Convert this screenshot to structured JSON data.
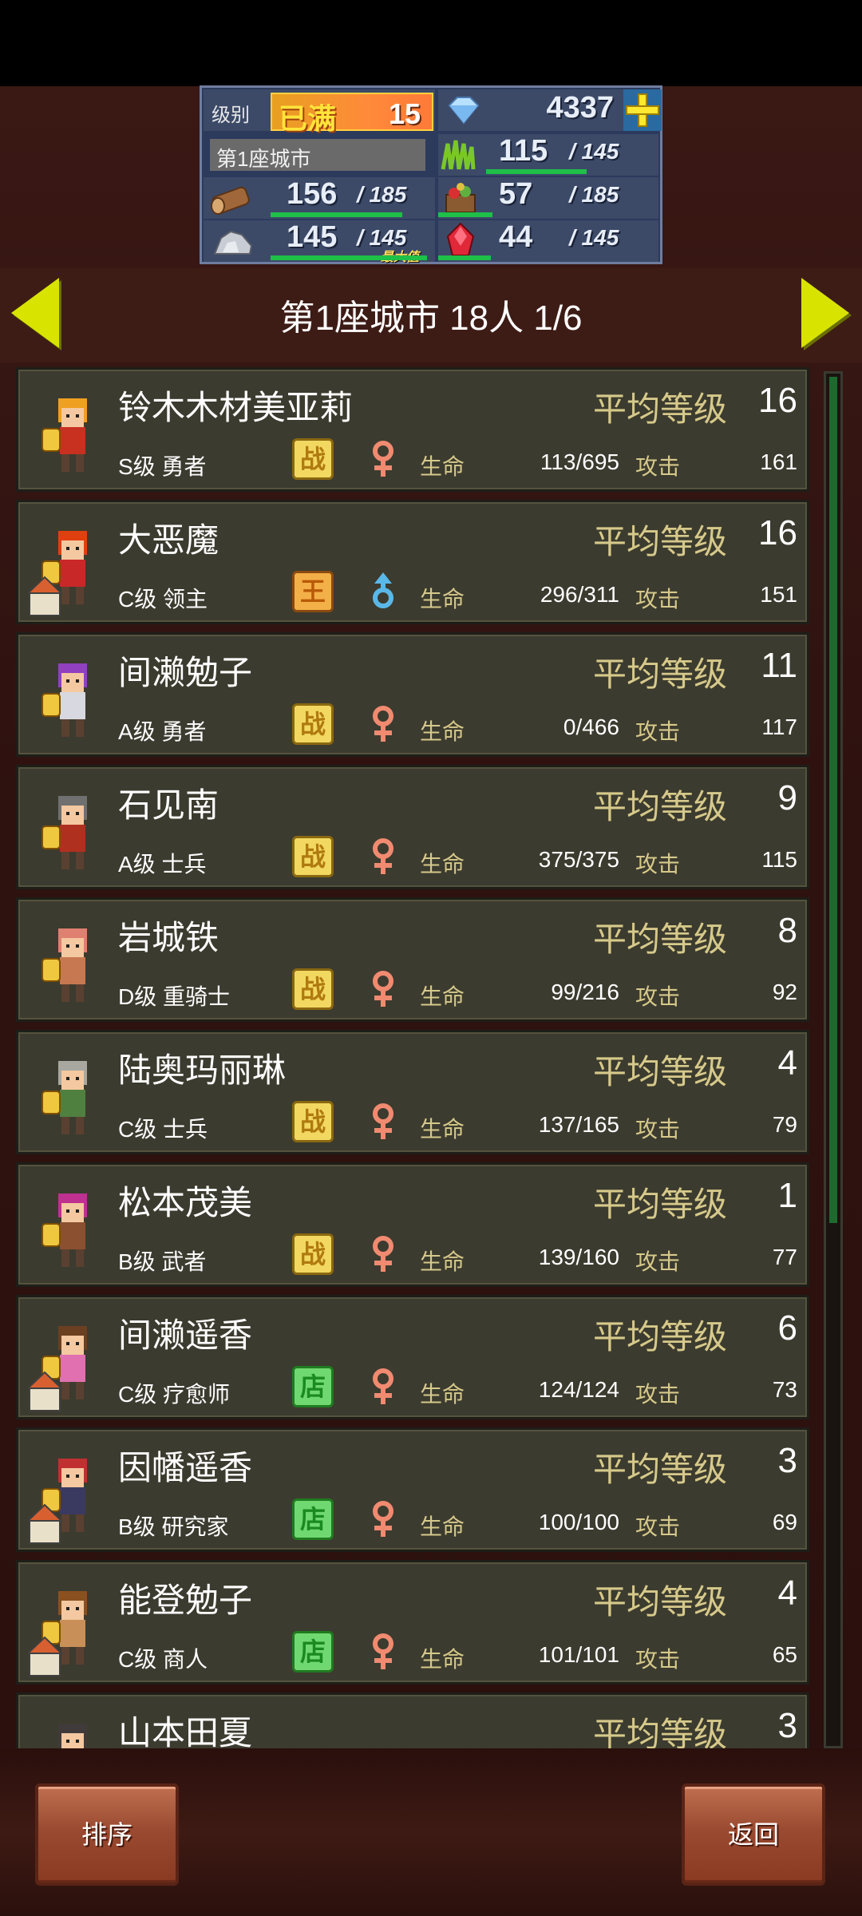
{
  "status": {
    "level_label": "级别",
    "max_label": "已满",
    "level": "15",
    "gems": "4337",
    "city_label": "第1座城市",
    "grass_current": "115",
    "grass_max": "/ 145",
    "wood_current": "156",
    "wood_max": "/ 185",
    "food_current": "57",
    "food_max": "/ 185",
    "ore_current": "145",
    "ore_max": "/ 145",
    "ore_maxtag": "最大值",
    "gem2_current": "44",
    "gem2_max": "/ 145",
    "fill": {
      "grass": 0.79,
      "wood": 0.84,
      "food": 0.31,
      "ore": 1.0,
      "gem2": 0.3
    }
  },
  "header": {
    "title": "第1座城市  18人 1/6"
  },
  "labels": {
    "avg_level": "平均等级",
    "hp": "生命",
    "attack": "攻击"
  },
  "characters": [
    {
      "name": "铃木木材美亚莉",
      "level": "16",
      "class": "S级 勇者",
      "badge": "战",
      "gender": "female",
      "hp": "113/695",
      "atk": "161",
      "house": false,
      "hair": "#f0a020",
      "armor": "#c83020"
    },
    {
      "name": "大恶魔",
      "level": "16",
      "class": "C级 领主",
      "badge": "王",
      "gender": "male",
      "hp": "296/311",
      "atk": "151",
      "house": true,
      "hair": "#e04010",
      "armor": "#c82828"
    },
    {
      "name": "间濑勉子",
      "level": "11",
      "class": "A级 勇者",
      "badge": "战",
      "gender": "female",
      "hp": "0/466",
      "atk": "117",
      "house": false,
      "hair": "#9040c0",
      "armor": "#d8d8e0"
    },
    {
      "name": "石见南",
      "level": "9",
      "class": "A级 士兵",
      "badge": "战",
      "gender": "female",
      "hp": "375/375",
      "atk": "115",
      "house": false,
      "hair": "#707070",
      "armor": "#b03020"
    },
    {
      "name": "岩城铁",
      "level": "8",
      "class": "D级 重骑士",
      "badge": "战",
      "gender": "female",
      "hp": "99/216",
      "atk": "92",
      "house": false,
      "hair": "#e08070",
      "armor": "#c87850"
    },
    {
      "name": "陆奥玛丽琳",
      "level": "4",
      "class": "C级 士兵",
      "badge": "战",
      "gender": "female",
      "hp": "137/165",
      "atk": "79",
      "house": false,
      "hair": "#a8a8a0",
      "armor": "#508040"
    },
    {
      "name": "松本茂美",
      "level": "1",
      "class": "B级 武者",
      "badge": "战",
      "gender": "female",
      "hp": "139/160",
      "atk": "77",
      "house": false,
      "hair": "#c03090",
      "armor": "#8a5030"
    },
    {
      "name": "间濑遥香",
      "level": "6",
      "class": "C级 疗愈师",
      "badge": "店",
      "gender": "female",
      "hp": "124/124",
      "atk": "73",
      "house": true,
      "hair": "#6a4020",
      "armor": "#e070b0"
    },
    {
      "name": "因幡遥香",
      "level": "3",
      "class": "B级 研究家",
      "badge": "店",
      "gender": "female",
      "hp": "100/100",
      "atk": "69",
      "house": true,
      "hair": "#c03030",
      "armor": "#3a3a60"
    },
    {
      "name": "能登勉子",
      "level": "4",
      "class": "C级 商人",
      "badge": "店",
      "gender": "female",
      "hp": "101/101",
      "atk": "65",
      "house": true,
      "hair": "#8a5020",
      "armor": "#c89058"
    },
    {
      "name": "山本田夏",
      "level": "3",
      "class": "",
      "badge": "",
      "gender": "female",
      "hp": "",
      "atk": "",
      "house": false,
      "hair": "#403a3a",
      "armor": "#505050"
    }
  ],
  "buttons": {
    "sort": "排序",
    "back": "返回"
  }
}
